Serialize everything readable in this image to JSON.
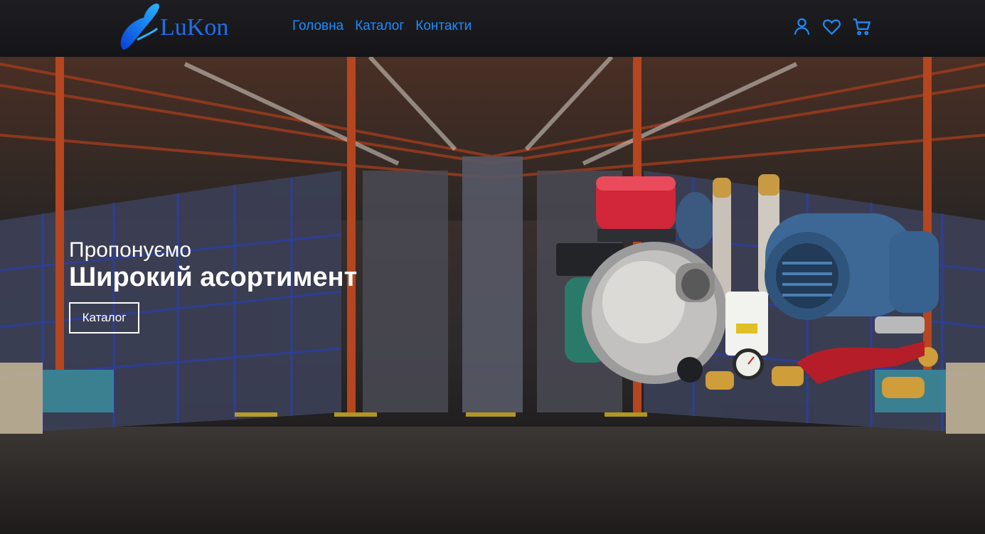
{
  "header": {
    "logo_text": "LuKon",
    "nav": [
      {
        "label": "Головна"
      },
      {
        "label": "Каталог"
      },
      {
        "label": "Контакти"
      }
    ],
    "icons": [
      "user-icon",
      "heart-icon",
      "cart-icon"
    ]
  },
  "hero": {
    "subtitle": "Пропонуємо",
    "title": "Широкий асортимент",
    "button_label": "Каталог"
  },
  "colors": {
    "accent": "#1e8bff",
    "header_bg": "#1b1b1e",
    "text_on_hero": "#ffffff"
  }
}
